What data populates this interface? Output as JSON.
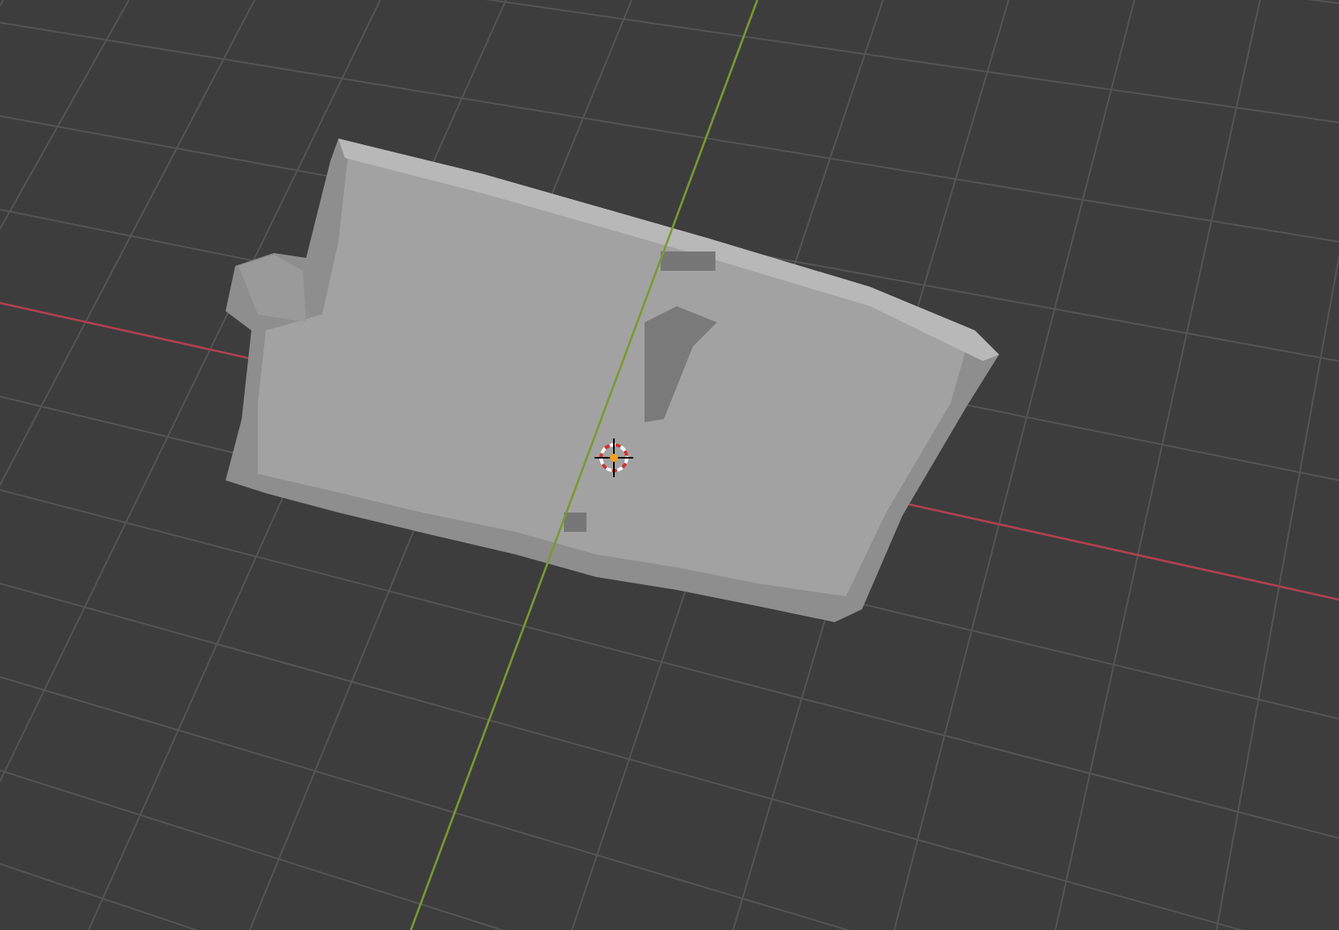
{
  "viewport": {
    "show_grid": true,
    "show_x_axis": true,
    "show_y_axis": true,
    "show_3d_cursor": true,
    "show_model": true
  }
}
